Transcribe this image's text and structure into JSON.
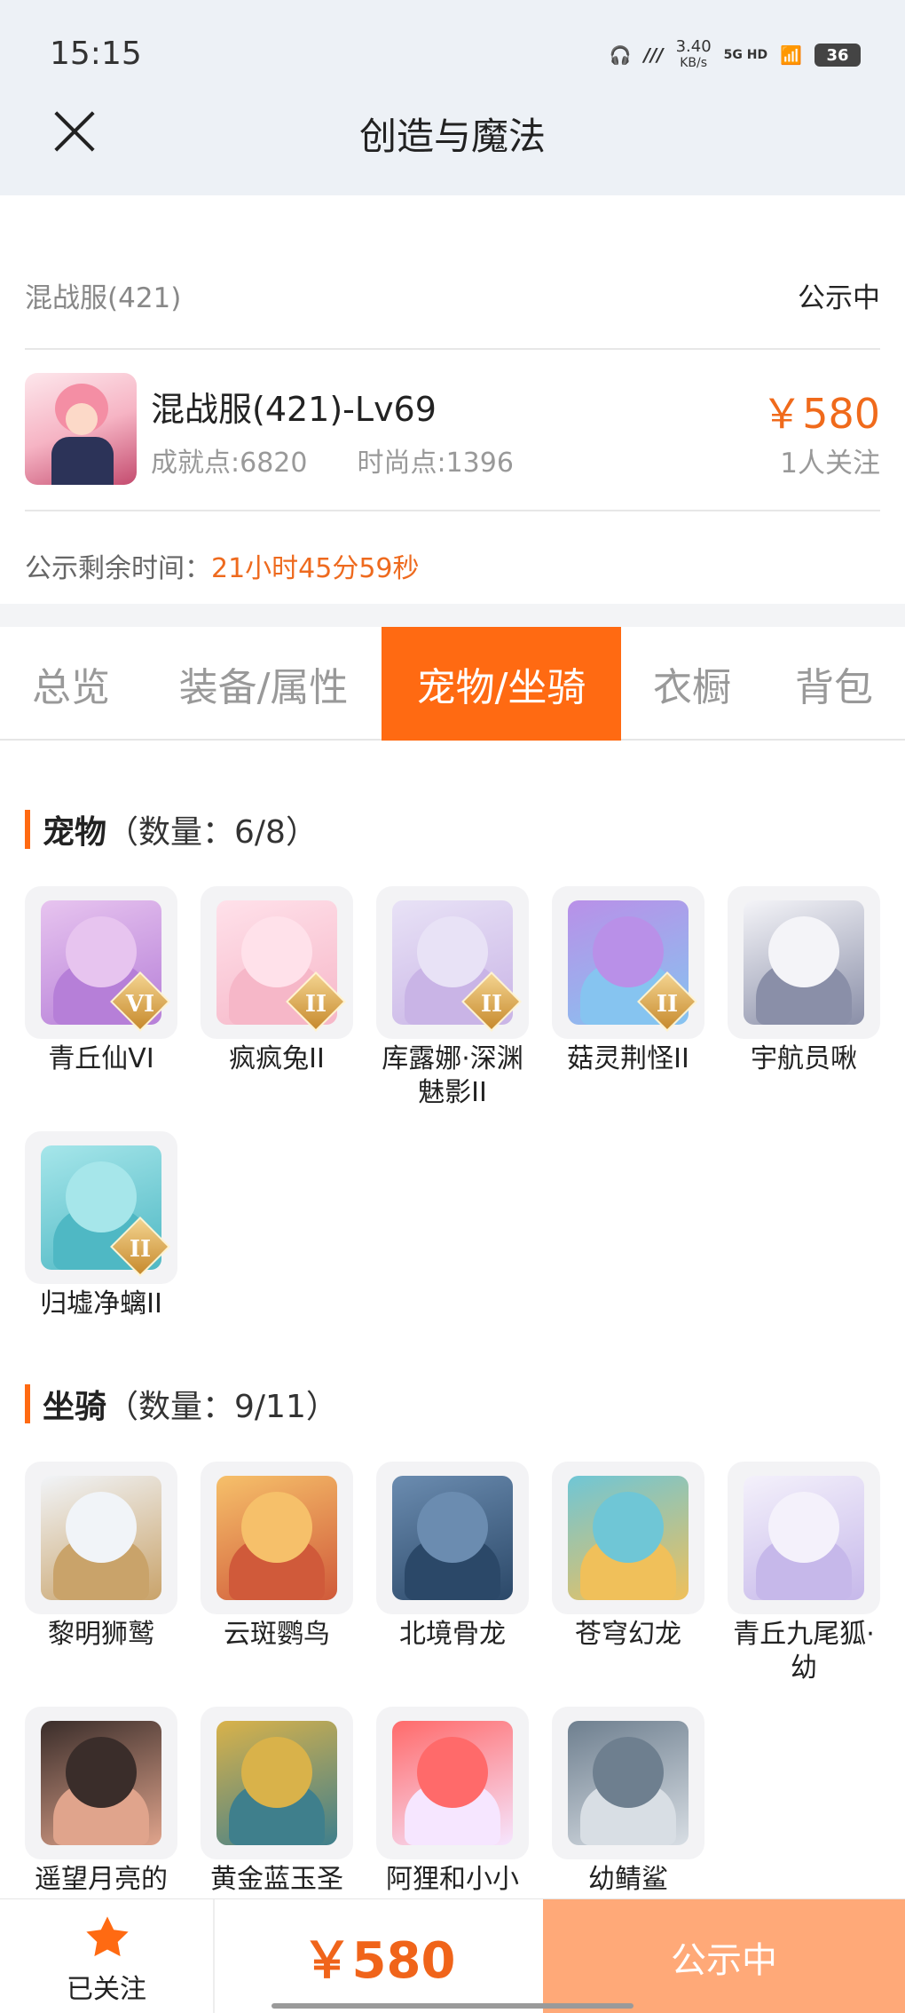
{
  "status_bar": {
    "time": "15:15",
    "net_speed_top": "3.40",
    "net_speed_bottom": "KB/s",
    "signal": "5G HD",
    "battery": "36"
  },
  "nav": {
    "title": "创造与魔法"
  },
  "listing": {
    "server": "混战服(421)",
    "status": "公示中",
    "char_name": "混战服(421)-Lv69",
    "achievement": "成就点:6820",
    "fashion": "时尚点:1396",
    "price": "￥580",
    "followers": "1人关注",
    "remain_label": "公示剩余时间：",
    "remain_value": "21小时45分59秒"
  },
  "tabs": [
    {
      "label": "总览"
    },
    {
      "label": "装备/属性"
    },
    {
      "label": "宠物/坐骑",
      "active": true
    },
    {
      "label": "衣橱"
    },
    {
      "label": "背包"
    }
  ],
  "pets": {
    "title": "宠物",
    "count": "（数量：6/8）",
    "items": [
      {
        "label": "青丘仙VI",
        "badge": "VI",
        "colors": [
          "#e7c4ef",
          "#b67fd8"
        ]
      },
      {
        "label": "疯疯兔II",
        "badge": "II",
        "colors": [
          "#ffe1ea",
          "#f6b7c8"
        ]
      },
      {
        "label": "库露娜·深渊魅影II",
        "badge": "II",
        "colors": [
          "#e8e2f6",
          "#c9b4e6"
        ]
      },
      {
        "label": "菇灵荆怪II",
        "badge": "II",
        "colors": [
          "#b990e8",
          "#86c4f0"
        ]
      },
      {
        "label": "宇航员啾",
        "badge": "",
        "colors": [
          "#f4f4f8",
          "#8a8fa8"
        ]
      },
      {
        "label": "归墟净螭II",
        "badge": "II",
        "colors": [
          "#a6e6ea",
          "#4fb8c4"
        ]
      }
    ]
  },
  "mounts": {
    "title": "坐骑",
    "count": "（数量：9/11）",
    "items": [
      {
        "label": "黎明狮鹫",
        "colors": [
          "#f1f4f8",
          "#c9a36a"
        ]
      },
      {
        "label": "云斑鹦鸟",
        "colors": [
          "#f6c06a",
          "#d05a3a"
        ]
      },
      {
        "label": "北境骨龙",
        "colors": [
          "#6b8cb0",
          "#2b4868"
        ]
      },
      {
        "label": "苍穹幻龙",
        "colors": [
          "#6fc6d6",
          "#f0c05a"
        ]
      },
      {
        "label": "青丘九尾狐·幼",
        "colors": [
          "#f4f1fb",
          "#c6b8ea"
        ]
      },
      {
        "label": "遥望月亮的",
        "colors": [
          "#3a2d2a",
          "#e0a48c"
        ]
      },
      {
        "label": "黄金蓝玉圣",
        "colors": [
          "#d9b24a",
          "#3f7f8c"
        ]
      },
      {
        "label": "阿狸和小小",
        "colors": [
          "#ff6a6a",
          "#f6e6ff"
        ]
      },
      {
        "label": "幼鲭鲨",
        "colors": [
          "#6e7f8f",
          "#d8dee4"
        ]
      }
    ]
  },
  "bottom": {
    "follow_label": "已关注",
    "price": "￥580",
    "status": "公示中"
  },
  "colors": {
    "accent": "#ff6a12",
    "price": "#f06a1b",
    "status_button": "#ffa978"
  }
}
